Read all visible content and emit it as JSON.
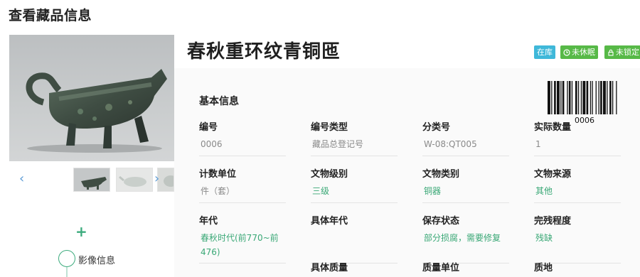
{
  "page": {
    "title": "查看藏品信息"
  },
  "item": {
    "title": "春秋重环纹青铜匜",
    "badges": {
      "status": "在库",
      "hibernate": "未休眠",
      "lock": "未锁定"
    },
    "barcode": "0006"
  },
  "gallery": {
    "prev": "‹",
    "next": "›"
  },
  "timeline": {
    "add": "+",
    "node_label": "影像信息"
  },
  "basic_info": {
    "section_title": "基本信息",
    "rows": [
      [
        {
          "label": "编号",
          "value": "0006",
          "style": "gray"
        },
        {
          "label": "编号类型",
          "value": "藏品总登记号",
          "style": "gray"
        },
        {
          "label": "分类号",
          "value": "W-08:QT005",
          "style": "gray"
        },
        {
          "label": "实际数量",
          "value": "1",
          "style": "gray"
        }
      ],
      [
        {
          "label": "计数单位",
          "value": "件（套）",
          "style": "gray"
        },
        {
          "label": "文物级别",
          "value": "三级",
          "style": "green"
        },
        {
          "label": "文物类别",
          "value": "铜器",
          "style": "green"
        },
        {
          "label": "文物来源",
          "value": "其他",
          "style": "green"
        }
      ],
      [
        {
          "label": "年代",
          "value": "春秋时代(前770~前476)",
          "style": "green"
        },
        {
          "label": "具体年代",
          "value": "",
          "style": "gray"
        },
        {
          "label": "保存状态",
          "value": "部分损腐，需要修复",
          "style": "green"
        },
        {
          "label": "完残程度",
          "value": "残缺",
          "style": "green"
        }
      ],
      [
        {
          "label": "",
          "value": "",
          "style": "gray"
        },
        {
          "label": "具体质量",
          "value": "",
          "style": "gray"
        },
        {
          "label": "质量单位",
          "value": "",
          "style": "gray"
        },
        {
          "label": "质地",
          "value": "",
          "style": "gray"
        }
      ]
    ]
  },
  "colors": {
    "accent_green": "#3cab7d",
    "badge_blue": "#3fb8d9",
    "badge_green": "#57b947",
    "arrow_blue": "#5b9bd5"
  }
}
